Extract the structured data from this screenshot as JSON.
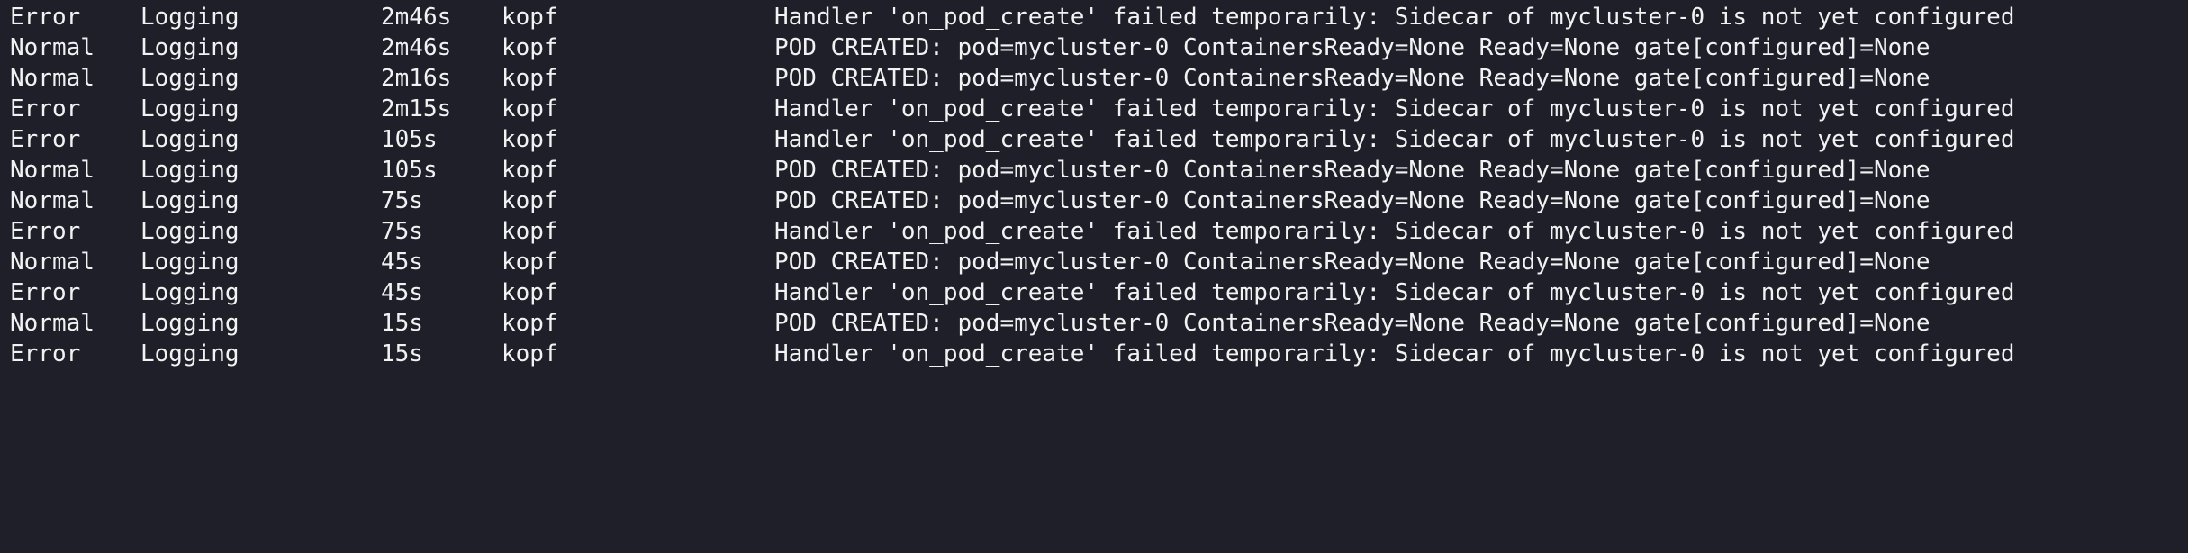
{
  "events": [
    {
      "type": "Error",
      "reason": "Logging",
      "age": "2m46s",
      "from": "kopf",
      "message": "Handler 'on_pod_create' failed temporarily: Sidecar of mycluster-0 is not yet configured"
    },
    {
      "type": "Normal",
      "reason": "Logging",
      "age": "2m46s",
      "from": "kopf",
      "message": "POD CREATED: pod=mycluster-0 ContainersReady=None Ready=None gate[configured]=None"
    },
    {
      "type": "Normal",
      "reason": "Logging",
      "age": "2m16s",
      "from": "kopf",
      "message": "POD CREATED: pod=mycluster-0 ContainersReady=None Ready=None gate[configured]=None"
    },
    {
      "type": "Error",
      "reason": "Logging",
      "age": "2m15s",
      "from": "kopf",
      "message": "Handler 'on_pod_create' failed temporarily: Sidecar of mycluster-0 is not yet configured"
    },
    {
      "type": "Error",
      "reason": "Logging",
      "age": "105s",
      "from": "kopf",
      "message": "Handler 'on_pod_create' failed temporarily: Sidecar of mycluster-0 is not yet configured"
    },
    {
      "type": "Normal",
      "reason": "Logging",
      "age": "105s",
      "from": "kopf",
      "message": "POD CREATED: pod=mycluster-0 ContainersReady=None Ready=None gate[configured]=None"
    },
    {
      "type": "Normal",
      "reason": "Logging",
      "age": "75s",
      "from": "kopf",
      "message": "POD CREATED: pod=mycluster-0 ContainersReady=None Ready=None gate[configured]=None"
    },
    {
      "type": "Error",
      "reason": "Logging",
      "age": "75s",
      "from": "kopf",
      "message": "Handler 'on_pod_create' failed temporarily: Sidecar of mycluster-0 is not yet configured"
    },
    {
      "type": "Normal",
      "reason": "Logging",
      "age": "45s",
      "from": "kopf",
      "message": "POD CREATED: pod=mycluster-0 ContainersReady=None Ready=None gate[configured]=None"
    },
    {
      "type": "Error",
      "reason": "Logging",
      "age": "45s",
      "from": "kopf",
      "message": "Handler 'on_pod_create' failed temporarily: Sidecar of mycluster-0 is not yet configured"
    },
    {
      "type": "Normal",
      "reason": "Logging",
      "age": "15s",
      "from": "kopf",
      "message": "POD CREATED: pod=mycluster-0 ContainersReady=None Ready=None gate[configured]=None"
    },
    {
      "type": "Error",
      "reason": "Logging",
      "age": "15s",
      "from": "kopf",
      "message": "Handler 'on_pod_create' failed temporarily: Sidecar of mycluster-0 is not yet configured"
    }
  ]
}
